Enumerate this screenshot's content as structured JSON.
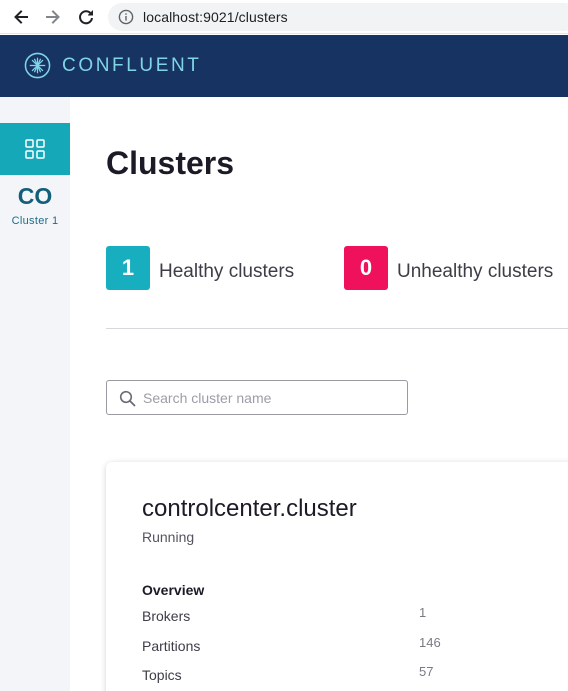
{
  "browser": {
    "url": "localhost:9021/clusters"
  },
  "header": {
    "brand": "CONFLUENT",
    "logo_icon": "confluent-starburst-logo"
  },
  "sidebar": {
    "cluster_abbr": "CO",
    "cluster_name": "Cluster 1",
    "active_color": "#14a8b8"
  },
  "page": {
    "title": "Clusters",
    "stats": {
      "healthy_count": "1",
      "healthy_label": "Healthy clusters",
      "healthy_color": "#17afc0",
      "unhealthy_count": "0",
      "unhealthy_label": "Unhealthy clusters",
      "unhealthy_color": "#f0115d"
    },
    "search": {
      "placeholder": "Search cluster name",
      "value": ""
    }
  },
  "cluster_card": {
    "name": "controlcenter.cluster",
    "status": "Running",
    "overview_heading": "Overview",
    "metrics": [
      {
        "label": "Brokers",
        "value": "1"
      },
      {
        "label": "Partitions",
        "value": "146"
      },
      {
        "label": "Topics",
        "value": "57"
      }
    ]
  },
  "colors": {
    "header_bg": "#173361",
    "brand_accent": "#7fd5e6"
  }
}
